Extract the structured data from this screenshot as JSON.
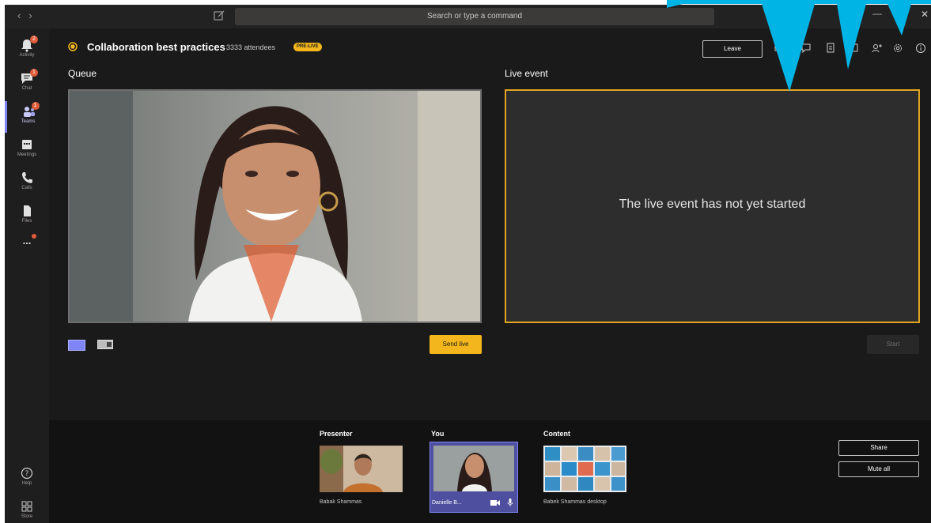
{
  "titlebar": {
    "search_placeholder": "Search or type a command",
    "back_glyph": "‹",
    "forward_glyph": "›",
    "minimize_glyph": "—",
    "close_glyph": "✕"
  },
  "rail": {
    "items": [
      {
        "label": "Activity",
        "icon": "bell-icon",
        "badge": "2"
      },
      {
        "label": "Chat",
        "icon": "chat-icon",
        "badge": "1"
      },
      {
        "label": "Teams",
        "icon": "teams-icon",
        "badge": "1",
        "active": true
      },
      {
        "label": "Meetings",
        "icon": "calendar-icon"
      },
      {
        "label": "Calls",
        "icon": "phone-icon"
      },
      {
        "label": "Files",
        "icon": "file-icon"
      },
      {
        "label": "",
        "icon": "more-icon",
        "dot": true
      },
      {
        "label": "Help",
        "icon": "help-icon"
      },
      {
        "label": "Store",
        "icon": "store-icon"
      }
    ],
    "more_glyph": "...",
    "help_glyph": "?"
  },
  "header": {
    "title": "Collaboration best practices",
    "attendees": "3333 attendees",
    "status_badge": "PRE-LIVE",
    "leave_label": "Leave"
  },
  "queue": {
    "label": "Queue"
  },
  "live": {
    "label": "Live event",
    "message": "The live event has not yet started"
  },
  "controls": {
    "send_live_label": "Send live",
    "start_label": "Start"
  },
  "tray": {
    "presenter_label": "Presenter",
    "presenter_name": "Babak Shammas",
    "you_label": "You",
    "you_name": "Danielle B...",
    "content_label": "Content",
    "content_name": "Babek Shammas desktop",
    "share_label": "Share",
    "mute_all_label": "Mute all"
  },
  "colors": {
    "accent": "#7f85f5",
    "live_yellow": "#f3b71d",
    "annotation_blue": "#00b4e6"
  }
}
